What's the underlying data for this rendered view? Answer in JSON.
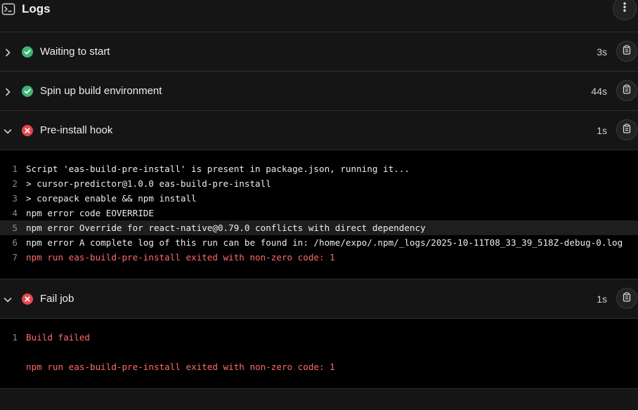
{
  "header": {
    "title": "Logs"
  },
  "steps": [
    {
      "name": "Waiting to start",
      "duration": "3s",
      "status": "success",
      "expanded": false
    },
    {
      "name": "Spin up build environment",
      "duration": "44s",
      "status": "success",
      "expanded": false
    },
    {
      "name": "Pre-install hook",
      "duration": "1s",
      "status": "error",
      "expanded": true,
      "lines": [
        {
          "n": "1",
          "text": "Script 'eas-build-pre-install' is present in package.json, running it..."
        },
        {
          "n": "2",
          "text": "> cursor-predictor@1.0.0 eas-build-pre-install"
        },
        {
          "n": "3",
          "text": "> corepack enable && npm install"
        },
        {
          "n": "4",
          "text": "npm error code EOVERRIDE"
        },
        {
          "n": "5",
          "text": "npm error Override for react-native@0.79.0 conflicts with direct dependency"
        },
        {
          "n": "6",
          "text": "npm error A complete log of this run can be found in: /home/expo/.npm/_logs/2025-10-11T08_33_39_518Z-debug-0.log"
        },
        {
          "n": "7",
          "text": "npm run eas-build-pre-install exited with non-zero code: 1"
        }
      ]
    },
    {
      "name": "Fail job",
      "duration": "1s",
      "status": "error",
      "expanded": true,
      "lines": [
        {
          "n": "1",
          "text": "Build failed"
        },
        {
          "n": "",
          "text": ""
        },
        {
          "n": "",
          "text": "npm run eas-build-pre-install exited with non-zero code: 1"
        }
      ]
    }
  ],
  "colors": {
    "success": "#3fb573",
    "error": "#e5484d",
    "error_text": "#ff6a6a"
  }
}
